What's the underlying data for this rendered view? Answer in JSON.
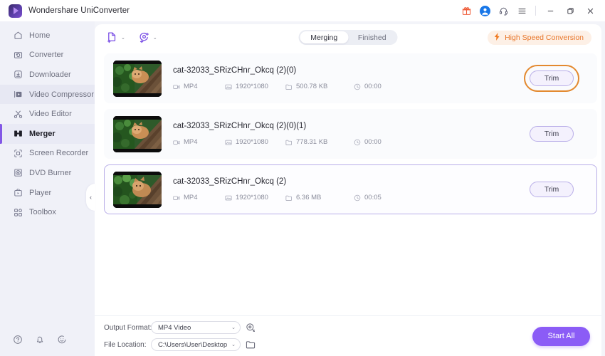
{
  "window": {
    "title": "Wondershare UniConverter",
    "logo_icon": "play-logo-icon",
    "controls": [
      {
        "name": "gift-icon",
        "glyph": "gift"
      },
      {
        "name": "account-avatar-icon",
        "glyph": "user"
      },
      {
        "name": "support-headset-icon",
        "glyph": "headset"
      },
      {
        "name": "menu-icon",
        "glyph": "hamburger"
      },
      {
        "name": "minimize-button",
        "glyph": "minimize"
      },
      {
        "name": "maximize-button",
        "glyph": "maximize"
      },
      {
        "name": "close-button",
        "glyph": "close"
      }
    ]
  },
  "sidebar": {
    "items": [
      {
        "label": "Home",
        "icon": "home-icon",
        "state": "normal"
      },
      {
        "label": "Converter",
        "icon": "converter-icon",
        "state": "normal"
      },
      {
        "label": "Downloader",
        "icon": "downloader-icon",
        "state": "normal"
      },
      {
        "label": "Video Compressor",
        "icon": "video-compressor-icon",
        "state": "hover"
      },
      {
        "label": "Video Editor",
        "icon": "video-editor-icon",
        "state": "normal"
      },
      {
        "label": "Merger",
        "icon": "merger-icon",
        "state": "active"
      },
      {
        "label": "Screen Recorder",
        "icon": "screen-recorder-icon",
        "state": "normal"
      },
      {
        "label": "DVD Burner",
        "icon": "dvd-burner-icon",
        "state": "normal"
      },
      {
        "label": "Player",
        "icon": "player-icon",
        "state": "normal"
      },
      {
        "label": "Toolbox",
        "icon": "toolbox-icon",
        "state": "normal"
      }
    ],
    "bottom_icons": [
      "help-icon",
      "notifications-bell-icon",
      "feedback-smiley-icon"
    ],
    "collapse_handle": "‹",
    "active_accent": "#8257e6"
  },
  "toolbar": {
    "add_file_icon": "add-file-icon",
    "add_device_icon": "add-from-device-icon",
    "caret": "⌄",
    "tabs": [
      {
        "label": "Merging",
        "active": true
      },
      {
        "label": "Finished",
        "active": false
      }
    ],
    "high_speed_label": "High Speed Conversion",
    "high_speed_icon": "lightning-bolt-icon",
    "high_speed_color": "#e8762a"
  },
  "files": [
    {
      "name": "cat-32033_SRizCHnr_Okcq (2)(0)",
      "format": "MP4",
      "resolution": "1920*1080",
      "size": "500.78 KB",
      "duration": "00:00",
      "trim_label": "Trim",
      "selected": false,
      "highlighted": true
    },
    {
      "name": "cat-32033_SRizCHnr_Okcq (2)(0)(1)",
      "format": "MP4",
      "resolution": "1920*1080",
      "size": "778.31 KB",
      "duration": "00:00",
      "trim_label": "Trim",
      "selected": false,
      "highlighted": false
    },
    {
      "name": "cat-32033_SRizCHnr_Okcq (2)",
      "format": "MP4",
      "resolution": "1920*1080",
      "size": "6.36 MB",
      "duration": "00:05",
      "trim_label": "Trim",
      "selected": true,
      "highlighted": false
    }
  ],
  "footer": {
    "output_format_label": "Output Format:",
    "output_format_value": "MP4 Video",
    "output_settings_icon": "output-settings-icon",
    "file_location_label": "File Location:",
    "file_location_value": "C:\\Users\\User\\Desktop",
    "folder_icon": "folder-icon",
    "start_all_label": "Start All",
    "start_all_color": "#8b5cf6"
  }
}
